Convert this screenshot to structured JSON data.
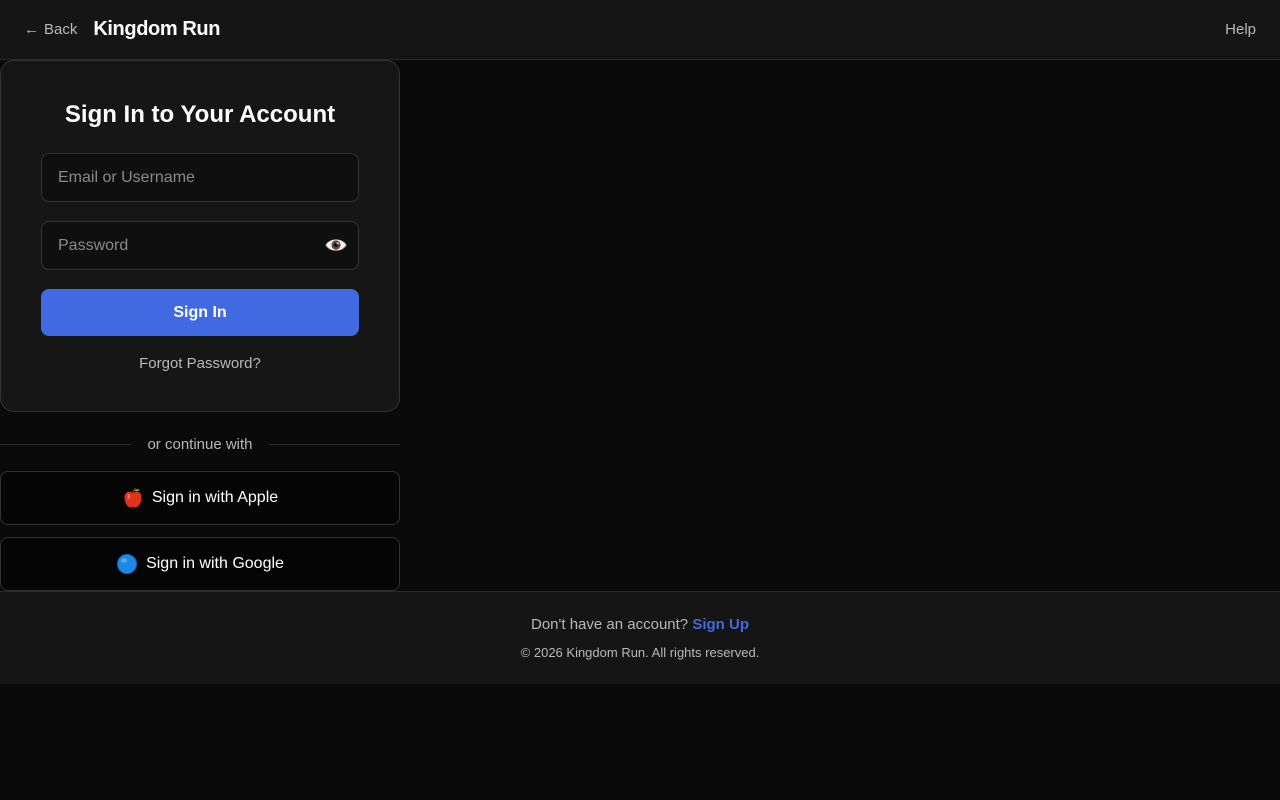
{
  "header": {
    "back_arrow": "←",
    "back_label": "Back",
    "title": "Kingdom Run",
    "help_label": "Help"
  },
  "login": {
    "title": "Sign In to Your Account",
    "email_placeholder": "Email or Username",
    "email_value": "",
    "password_placeholder": "Password",
    "password_value": "",
    "password_toggle_icon": "eye-icon",
    "signin_label": "Sign In",
    "forgot_label": "Forgot Password?"
  },
  "divider": {
    "label": "or continue with"
  },
  "social": {
    "apple": {
      "icon": "apple-icon",
      "label": "Sign in with Apple"
    },
    "google": {
      "icon": "google-icon",
      "label": "Sign in with Google"
    }
  },
  "footer": {
    "signup_prompt": "Don't have an account?",
    "signup_label": "Sign Up",
    "copyright": "© 2026 Kingdom Run. All rights reserved."
  },
  "colors": {
    "background": "#0a0a0a",
    "surface": "#151515",
    "accent": "#4169e1",
    "muted_text": "#b8b8b8"
  }
}
